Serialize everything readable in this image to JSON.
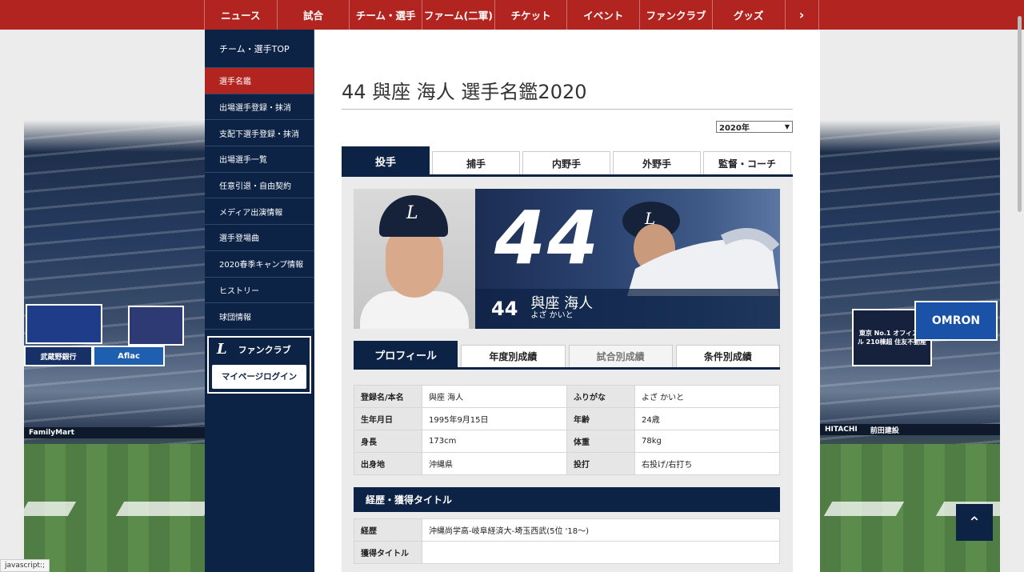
{
  "nav": {
    "items": [
      "ニュース",
      "試合",
      "チーム・選手",
      "ファーム(二軍)",
      "チケット",
      "イベント",
      "ファンクラブ",
      "グッズ"
    ],
    "more": "›"
  },
  "sidebar": {
    "top": "チーム・選手TOP",
    "items": [
      {
        "label": "選手名鑑",
        "active": true
      },
      {
        "label": "出場選手登録・抹消"
      },
      {
        "label": "支配下選手登録・抹消"
      },
      {
        "label": "出場選手一覧"
      },
      {
        "label": "任意引退・自由契約"
      },
      {
        "label": "メディア出演情報"
      },
      {
        "label": "選手登場曲"
      },
      {
        "label": "2020春季キャンプ情報"
      },
      {
        "label": "ヒストリー"
      },
      {
        "label": "球団情報"
      }
    ],
    "fanclub_logo": "L",
    "fanclub_label": "ファンクラブ",
    "mypage_login": "マイページログイン"
  },
  "page": {
    "title": "44 與座 海人 選手名鑑2020",
    "year_select": "2020年"
  },
  "position_tabs": [
    {
      "label": "投手",
      "active": true
    },
    {
      "label": "捕手"
    },
    {
      "label": "内野手"
    },
    {
      "label": "外野手"
    },
    {
      "label": "監督・コーチ"
    }
  ],
  "player": {
    "number": "44",
    "name": "與座 海人",
    "kana": "よざ かいと",
    "cap_logo": "L"
  },
  "profile_tabs": [
    {
      "label": "プロフィール",
      "active": true
    },
    {
      "label": "年度別成績"
    },
    {
      "label": "試合別成績",
      "disabled": true
    },
    {
      "label": "条件別成績"
    }
  ],
  "profile": {
    "rows": [
      {
        "k1": "登録名/本名",
        "v1": "與座 海人",
        "k2": "ふりがな",
        "v2": "よざ かいと"
      },
      {
        "k1": "生年月日",
        "v1": "1995年9月15日",
        "k2": "年齢",
        "v2": "24歳"
      },
      {
        "k1": "身長",
        "v1": "173cm",
        "k2": "体重",
        "v2": "78kg"
      },
      {
        "k1": "出身地",
        "v1": "沖縄県",
        "k2": "投打",
        "v2": "右投げ/右打ち"
      }
    ]
  },
  "career": {
    "heading": "経歴・獲得タイトル",
    "rows": [
      {
        "k": "経歴",
        "v": "沖縄尚学高-岐阜経済大-埼玉西武(5位 '18〜)"
      },
      {
        "k": "獲得タイトル",
        "v": ""
      }
    ]
  },
  "ads": {
    "left": [
      "Aflac",
      "武蔵野銀行",
      "FamilyMart"
    ],
    "right": [
      "東京 No.1 オフィスビル 210棟超 住友不動産",
      "OMRON",
      "HITACHI",
      "前田建設"
    ]
  },
  "to_top": "⌃",
  "status": "javascript:;",
  "colors": {
    "brand_red": "#b2241f",
    "navy": "#0d2346"
  }
}
